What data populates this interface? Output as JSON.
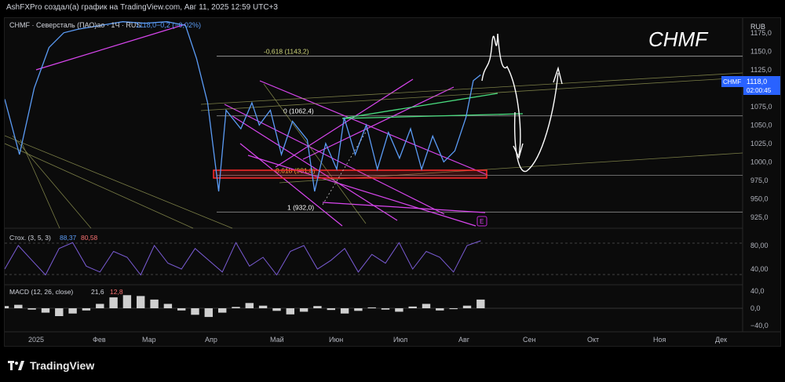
{
  "header": {
    "caption": "AshFXPro создал(а) график на TradingView.com, Авг 11, 2025 12:59 UTC+3"
  },
  "legend": {
    "symbol": "CHMF · Северсталь (ПАО)ао · 1Ч · RUS",
    "last": "1118,0",
    "change": "−0,2 (−0,02%)"
  },
  "watermark": "CHMF",
  "currency": "RUB",
  "price_tag": {
    "symbol": "CHMF",
    "price": "1118,0",
    "timer": "02:00:45"
  },
  "event_marker": "E",
  "stoch_label": {
    "name": "Стох. (3, 5, 3)",
    "k": "88,37",
    "d": "80,58"
  },
  "macd_label": {
    "name": "MACD (12, 26, close)",
    "hist": "21,6",
    "signal": "12,8"
  },
  "footer": {
    "brand": "TradingView"
  },
  "colors": {
    "price": "#5b9cf6",
    "fib": "#cfd67a",
    "pink": "#d946ef",
    "green": "#4ade80",
    "box": "#ff2a2a",
    "stoch": "#7b5cd6",
    "macd_hist": "#e0e0e0",
    "macd_red": "#e53935",
    "drawing": "#ffffff"
  },
  "chart_data": [
    {
      "type": "line",
      "panel": "price",
      "ylim": [
        910,
        1195
      ],
      "yticks": [
        "1175,0",
        "1150,0",
        "1125,0",
        "1100,0",
        "1075,0",
        "1050,0",
        "1025,0",
        "1000,0",
        "975,0",
        "950,0",
        "925,0"
      ],
      "xticks": [
        "2025",
        "Фев",
        "Мар",
        "Апр",
        "Май",
        "Июн",
        "Июл",
        "Авг",
        "Сен",
        "Окт",
        "Ноя",
        "Дек"
      ],
      "fib_levels": [
        {
          "label": "-0,618 (1143,2)",
          "value": 1143.2
        },
        {
          "label": "0 (1062,4)",
          "value": 1062.4
        },
        {
          "label": "0,618 (981,8)",
          "value": 981.8
        },
        {
          "label": "1 (932,0)",
          "value": 932.0
        }
      ],
      "approx_path": [
        [
          0.0,
          1085
        ],
        [
          0.02,
          1010
        ],
        [
          0.04,
          1100
        ],
        [
          0.06,
          1155
        ],
        [
          0.08,
          1175
        ],
        [
          0.1,
          1180
        ],
        [
          0.13,
          1185
        ],
        [
          0.16,
          1190
        ],
        [
          0.19,
          1188
        ],
        [
          0.22,
          1190
        ],
        [
          0.245,
          1185
        ],
        [
          0.26,
          1140
        ],
        [
          0.275,
          1080
        ],
        [
          0.29,
          960
        ],
        [
          0.3,
          1070
        ],
        [
          0.32,
          1045
        ],
        [
          0.335,
          1080
        ],
        [
          0.345,
          1050
        ],
        [
          0.36,
          1070
        ],
        [
          0.375,
          1010
        ],
        [
          0.39,
          1055
        ],
        [
          0.41,
          1030
        ],
        [
          0.42,
          960
        ],
        [
          0.435,
          1025
        ],
        [
          0.45,
          990
        ],
        [
          0.46,
          1060
        ],
        [
          0.475,
          1010
        ],
        [
          0.49,
          1050
        ],
        [
          0.505,
          990
        ],
        [
          0.52,
          1040
        ],
        [
          0.535,
          1005
        ],
        [
          0.55,
          1045
        ],
        [
          0.565,
          990
        ],
        [
          0.58,
          1035
        ],
        [
          0.595,
          1000
        ],
        [
          0.61,
          1015
        ],
        [
          0.625,
          1060
        ],
        [
          0.635,
          1110
        ],
        [
          0.645,
          1118
        ]
      ]
    },
    {
      "type": "line",
      "panel": "stochastic",
      "ylim": [
        20,
        100
      ],
      "yticks": [
        "80,00",
        "40,00"
      ],
      "series": [
        {
          "name": "%K",
          "values": [
            40,
            80,
            55,
            30,
            75,
            85,
            45,
            35,
            70,
            60,
            30,
            80,
            50,
            40,
            75,
            55,
            35,
            85,
            45,
            60,
            30,
            70,
            80,
            40,
            55,
            75,
            35,
            65,
            50,
            85,
            40,
            70,
            60,
            35,
            80,
            88
          ]
        }
      ]
    },
    {
      "type": "bar",
      "panel": "macd",
      "ylim": [
        -45,
        45
      ],
      "yticks": [
        "40,0",
        "0,0",
        "−40,0"
      ],
      "series": [
        {
          "name": "hist",
          "values": [
            5,
            8,
            -3,
            -10,
            -18,
            -12,
            -5,
            10,
            25,
            30,
            28,
            20,
            10,
            -5,
            -15,
            -20,
            -10,
            3,
            12,
            6,
            -6,
            -14,
            -8,
            5,
            -4,
            -12,
            -6,
            2,
            -3,
            -8,
            4,
            10,
            -5,
            -2,
            6,
            20
          ]
        }
      ]
    }
  ]
}
